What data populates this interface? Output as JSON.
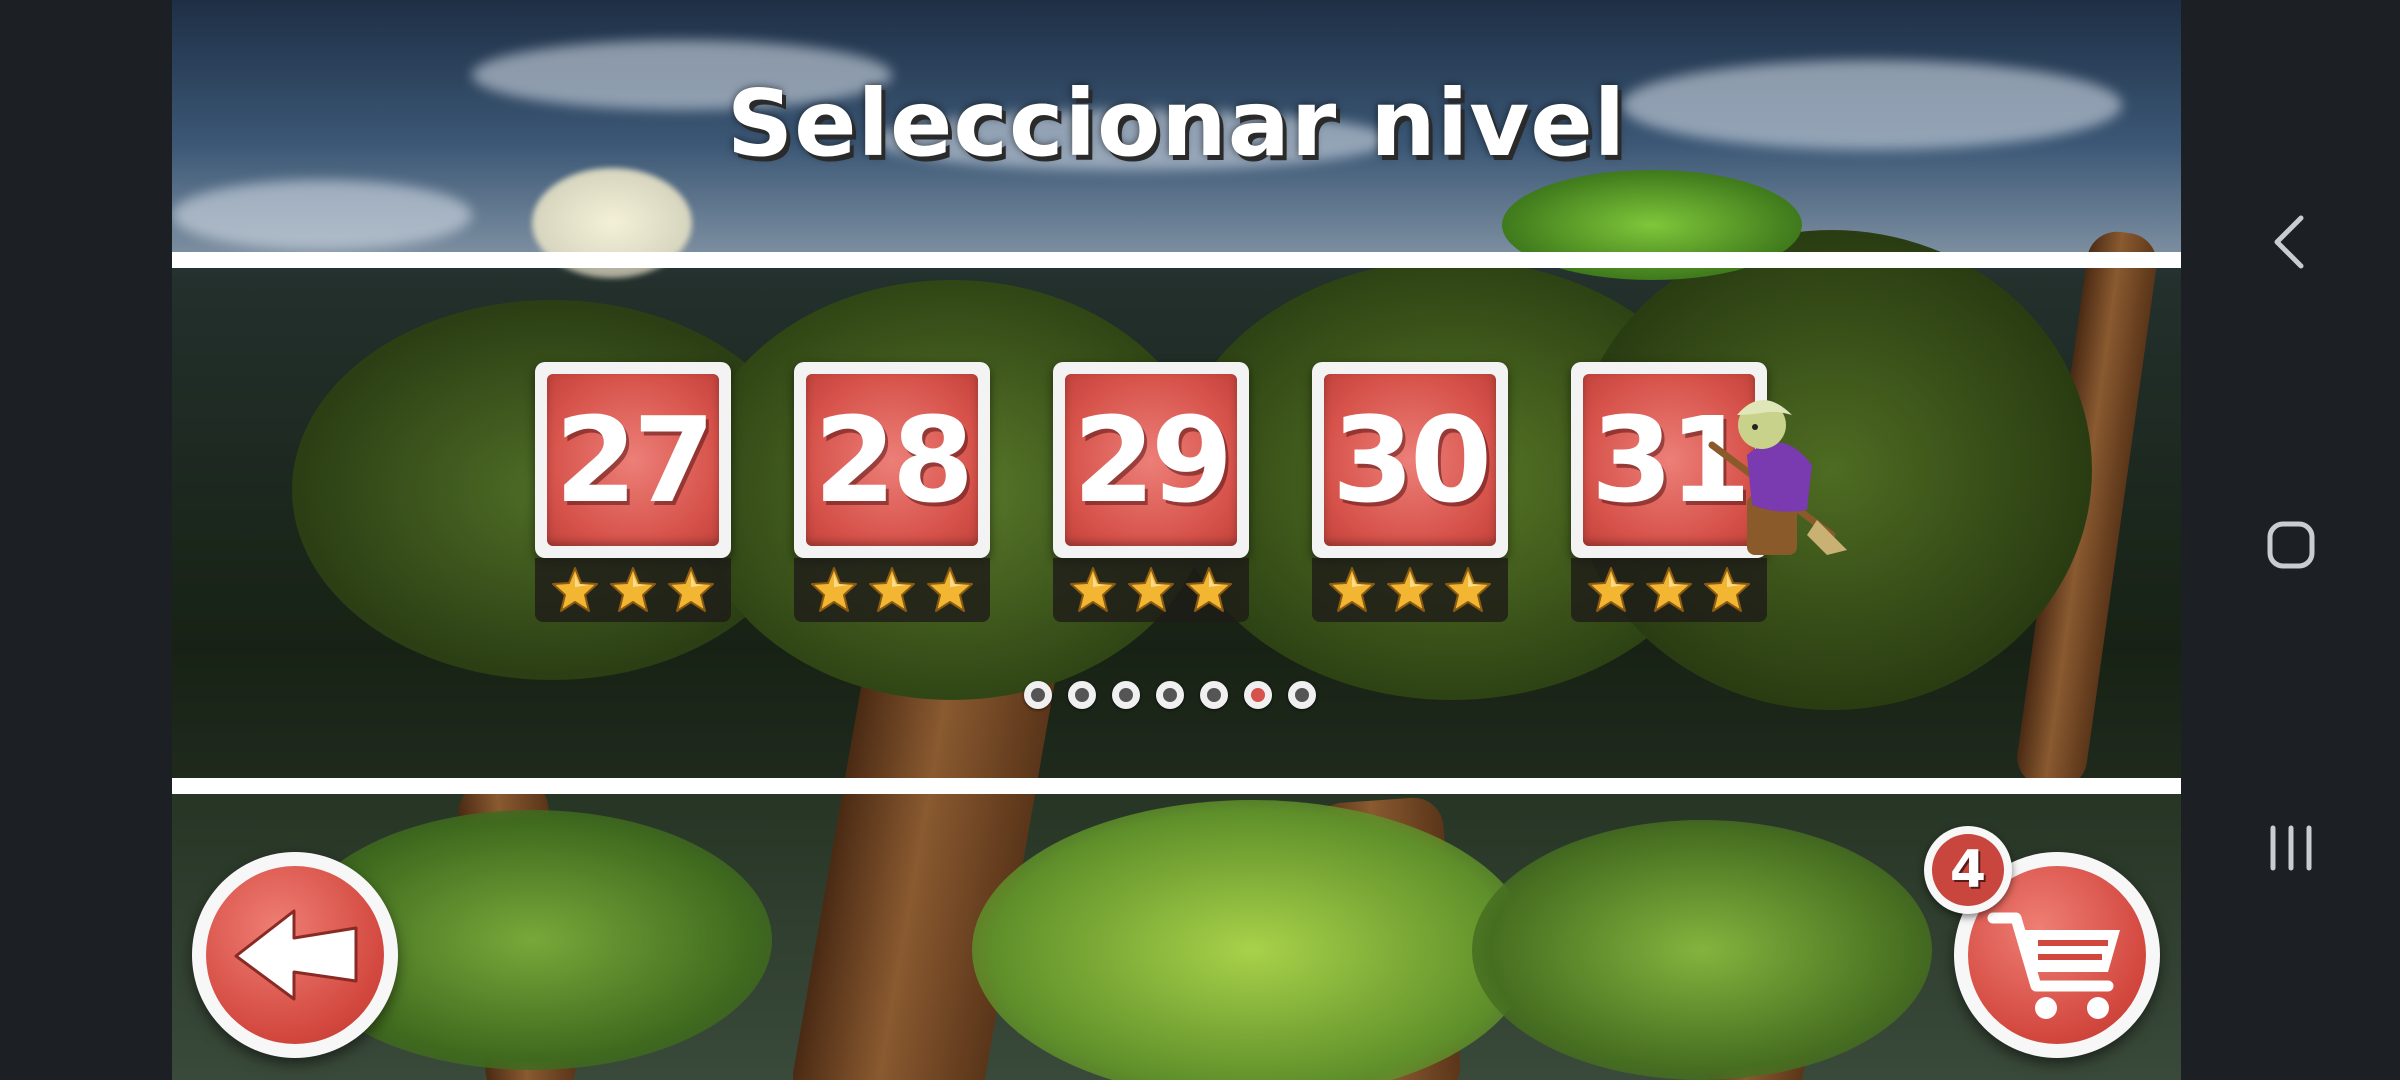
{
  "screen": {
    "title": "Seleccionar nivel"
  },
  "levels": [
    {
      "number": "27",
      "stars": 3
    },
    {
      "number": "28",
      "stars": 3
    },
    {
      "number": "29",
      "stars": 3
    },
    {
      "number": "30",
      "stars": 3
    },
    {
      "number": "31",
      "stars": 3
    }
  ],
  "pagination": {
    "total_pages": 7,
    "current_page": 6
  },
  "buttons": {
    "back_icon": "arrow-left-icon",
    "shop_icon": "shopping-cart-icon",
    "shop_badge_count": "4"
  },
  "android_nav": {
    "back_icon": "chevron-left-icon",
    "home_icon": "rounded-square-icon",
    "recents_icon": "three-lines-icon"
  },
  "colors": {
    "tile_red": "#d6524a",
    "star_gold": "#f2b632",
    "active_dot": "#d6524a",
    "background": "#1c2025"
  }
}
